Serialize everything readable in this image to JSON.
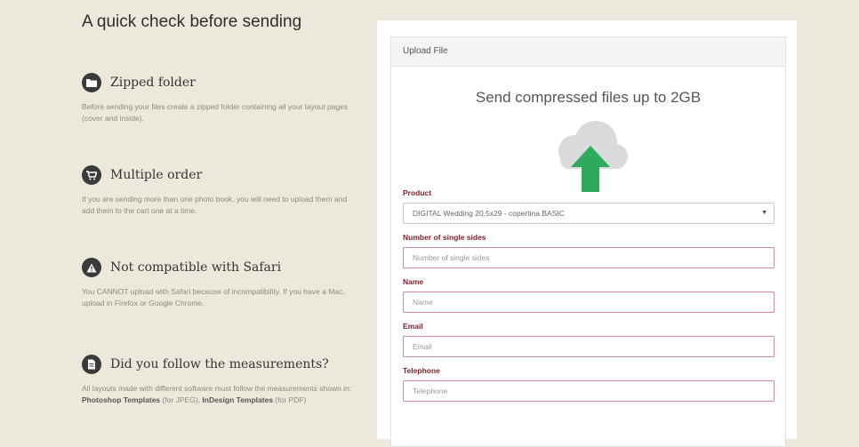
{
  "left": {
    "title": "A quick check before sending",
    "tips": [
      {
        "icon": "folder-icon",
        "title": "Zipped folder",
        "body": "Before sending your files create a zipped folder containing all your layout pages (cover and inside)."
      },
      {
        "icon": "cart-icon",
        "title": "Multiple order",
        "body": "If you are sending more than one photo book, you will need to upload them and add them to the cart one at a time."
      },
      {
        "icon": "warning-icon",
        "title": "Not compatible with Safari",
        "body": "You CANNOT upload with Safari because of incompatibility. If you have a Mac, upload in Firefox or Google Chrome."
      },
      {
        "icon": "document-icon",
        "title": "Did you follow the measurements?",
        "body_pre": "All layouts made with different software must follow the measurements shown in: ",
        "body_link1": "Photoshop Templates",
        "body_mid": " (for JPEG), ",
        "body_link2": "InDesign Templates",
        "body_post": " (for PDF)"
      }
    ]
  },
  "upload": {
    "header": "Upload File",
    "title": "Send compressed files up to 2GB",
    "icon": "cloud-upload-icon",
    "colors": {
      "cloud": "#d9dadb",
      "arrow": "#2eaa5c",
      "label": "#7a1f2b",
      "field_border": "#d28a96"
    },
    "fields": {
      "product": {
        "label": "Product",
        "value": "DIGITAL Wedding 20,5x29 - copertina BASIC"
      },
      "sides": {
        "label": "Number of single sides",
        "placeholder": "Number of single sides"
      },
      "name": {
        "label": "Name",
        "placeholder": "Name"
      },
      "email": {
        "label": "Email",
        "placeholder": "Email"
      },
      "telephone": {
        "label": "Telephone",
        "placeholder": "Telephone"
      }
    }
  }
}
